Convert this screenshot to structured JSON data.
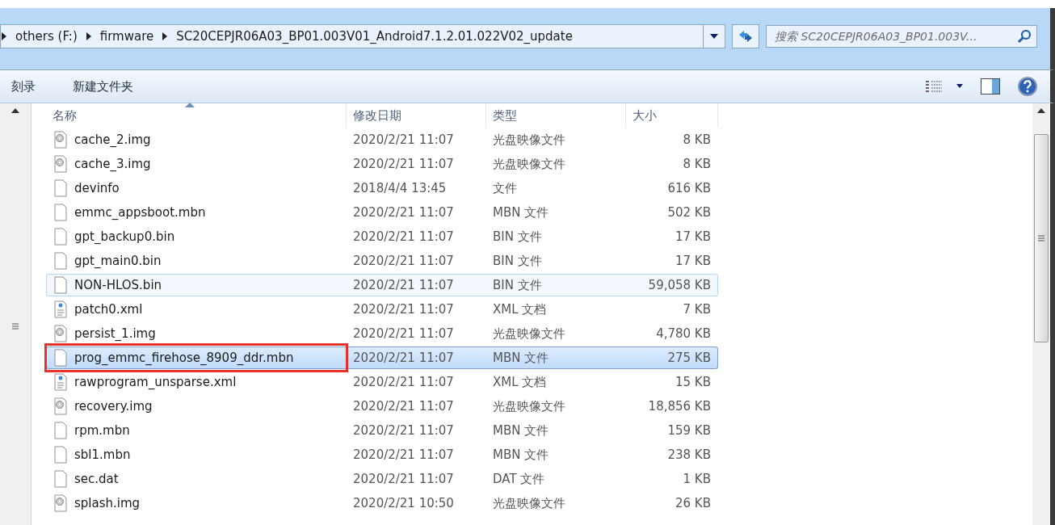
{
  "breadcrumb": [
    "others (F:)",
    "firmware",
    "SC20CEPJR06A03_BP01.003V01_Android7.1.2.01.022V02_update"
  ],
  "search": {
    "placeholder": "搜索 SC20CEPJR06A03_BP01.003V..."
  },
  "toolbar": [
    "刻录",
    "新建文件夹"
  ],
  "columns": [
    {
      "label": "名称",
      "sorted": true
    },
    {
      "label": "修改日期",
      "sorted": false
    },
    {
      "label": "类型",
      "sorted": false
    },
    {
      "label": "大小",
      "sorted": false
    }
  ],
  "rows": [
    {
      "kind": "image",
      "name": "cache_2.img",
      "date": "2020/2/21 11:07",
      "type": "光盘映像文件",
      "size": "8 KB",
      "hovered": false,
      "selected": false,
      "annotated": false
    },
    {
      "kind": "image",
      "name": "cache_3.img",
      "date": "2020/2/21 11:07",
      "type": "光盘映像文件",
      "size": "8 KB",
      "hovered": false,
      "selected": false,
      "annotated": false
    },
    {
      "kind": "file",
      "name": "devinfo",
      "date": "2018/4/4 13:45",
      "type": "文件",
      "size": "616 KB",
      "hovered": false,
      "selected": false,
      "annotated": false
    },
    {
      "kind": "file",
      "name": "emmc_appsboot.mbn",
      "date": "2020/2/21 11:07",
      "type": "MBN 文件",
      "size": "502 KB",
      "hovered": false,
      "selected": false,
      "annotated": false
    },
    {
      "kind": "file",
      "name": "gpt_backup0.bin",
      "date": "2020/2/21 11:07",
      "type": "BIN 文件",
      "size": "17 KB",
      "hovered": false,
      "selected": false,
      "annotated": false
    },
    {
      "kind": "file",
      "name": "gpt_main0.bin",
      "date": "2020/2/21 11:07",
      "type": "BIN 文件",
      "size": "17 KB",
      "hovered": false,
      "selected": false,
      "annotated": false
    },
    {
      "kind": "file",
      "name": "NON-HLOS.bin",
      "date": "2020/2/21 11:07",
      "type": "BIN 文件",
      "size": "59,058 KB",
      "hovered": true,
      "selected": false,
      "annotated": false
    },
    {
      "kind": "xml",
      "name": "patch0.xml",
      "date": "2020/2/21 11:07",
      "type": "XML 文档",
      "size": "7 KB",
      "hovered": false,
      "selected": false,
      "annotated": false
    },
    {
      "kind": "image",
      "name": "persist_1.img",
      "date": "2020/2/21 11:07",
      "type": "光盘映像文件",
      "size": "4,780 KB",
      "hovered": false,
      "selected": false,
      "annotated": false
    },
    {
      "kind": "file",
      "name": "prog_emmc_firehose_8909_ddr.mbn",
      "date": "2020/2/21 11:07",
      "type": "MBN 文件",
      "size": "275 KB",
      "hovered": false,
      "selected": true,
      "annotated": true
    },
    {
      "kind": "xml",
      "name": "rawprogram_unsparse.xml",
      "date": "2020/2/21 11:07",
      "type": "XML 文档",
      "size": "15 KB",
      "hovered": false,
      "selected": false,
      "annotated": false
    },
    {
      "kind": "image",
      "name": "recovery.img",
      "date": "2020/2/21 11:07",
      "type": "光盘映像文件",
      "size": "18,856 KB",
      "hovered": false,
      "selected": false,
      "annotated": false
    },
    {
      "kind": "file",
      "name": "rpm.mbn",
      "date": "2020/2/21 11:07",
      "type": "MBN 文件",
      "size": "159 KB",
      "hovered": false,
      "selected": false,
      "annotated": false
    },
    {
      "kind": "file",
      "name": "sbl1.mbn",
      "date": "2020/2/21 11:07",
      "type": "MBN 文件",
      "size": "238 KB",
      "hovered": false,
      "selected": false,
      "annotated": false
    },
    {
      "kind": "file",
      "name": "sec.dat",
      "date": "2020/2/21 11:07",
      "type": "DAT 文件",
      "size": "1 KB",
      "hovered": false,
      "selected": false,
      "annotated": false
    },
    {
      "kind": "image",
      "name": "splash.img",
      "date": "2020/2/21 10:50",
      "type": "光盘映像文件",
      "size": "26 KB",
      "hovered": false,
      "selected": false,
      "annotated": false
    }
  ]
}
